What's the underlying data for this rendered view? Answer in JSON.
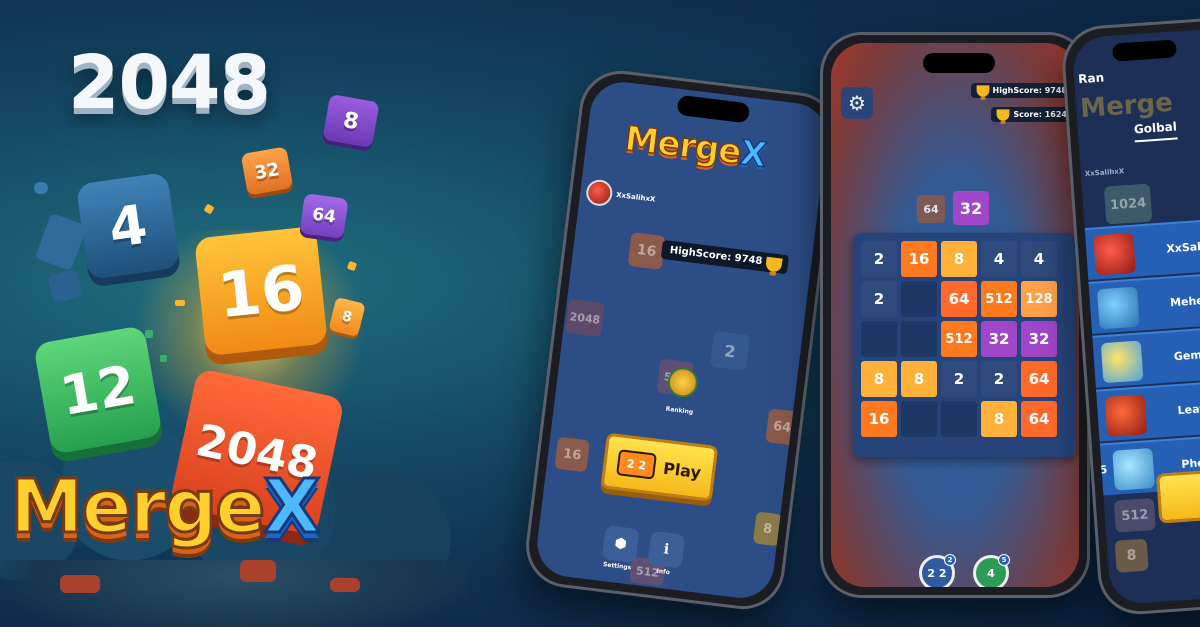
{
  "hero": {
    "title": "2048",
    "logo_main": "Merge",
    "logo_x": "X",
    "cubes": {
      "c4": "4",
      "c16": "16",
      "c12": "12",
      "c2048": "2048",
      "c32": "32",
      "c8a": "8",
      "c64": "64",
      "c8b": "8"
    }
  },
  "phone1": {
    "logo_main": "Merge",
    "logo_x": "X",
    "username": "XxSalihxX",
    "highscore_label": "HighScore: 9748",
    "ranking_label": "Ranking",
    "play_label": "Play",
    "play_icon_text": "2 2",
    "settings_label": "Settings",
    "info_label": "Info",
    "bg_tiles": [
      "16",
      "2048",
      "2",
      "512",
      "64",
      "16",
      "8",
      "512"
    ]
  },
  "phone2": {
    "highscore_label": "HighScore: 9748",
    "score_label": "Score: 1624",
    "next_tiles": [
      "64",
      "32"
    ],
    "board": [
      [
        "2",
        "16",
        "8",
        "4",
        "4"
      ],
      [
        "2",
        "",
        "64",
        "512",
        "128"
      ],
      [
        "",
        "",
        "512",
        "32",
        "32"
      ],
      [
        "8",
        "8",
        "2",
        "2",
        "64"
      ],
      [
        "16",
        "",
        "",
        "8",
        "64"
      ]
    ],
    "booster1_text": "2 2",
    "booster1_count": "2",
    "booster2_text": "4",
    "booster2_count": "5"
  },
  "phone3": {
    "header": "Ran",
    "tab_label": "Golbal",
    "current_user": "XxSalihxX",
    "rows": [
      {
        "rank": "",
        "name": "XxSalih"
      },
      {
        "rank": "",
        "name": "Meher"
      },
      {
        "rank": "",
        "name": "Gem"
      },
      {
        "rank": "",
        "name": "Leaf"
      },
      {
        "rank": "5",
        "name": "Pho"
      }
    ],
    "bg_tiles": [
      "1024",
      "512",
      "8"
    ]
  }
}
